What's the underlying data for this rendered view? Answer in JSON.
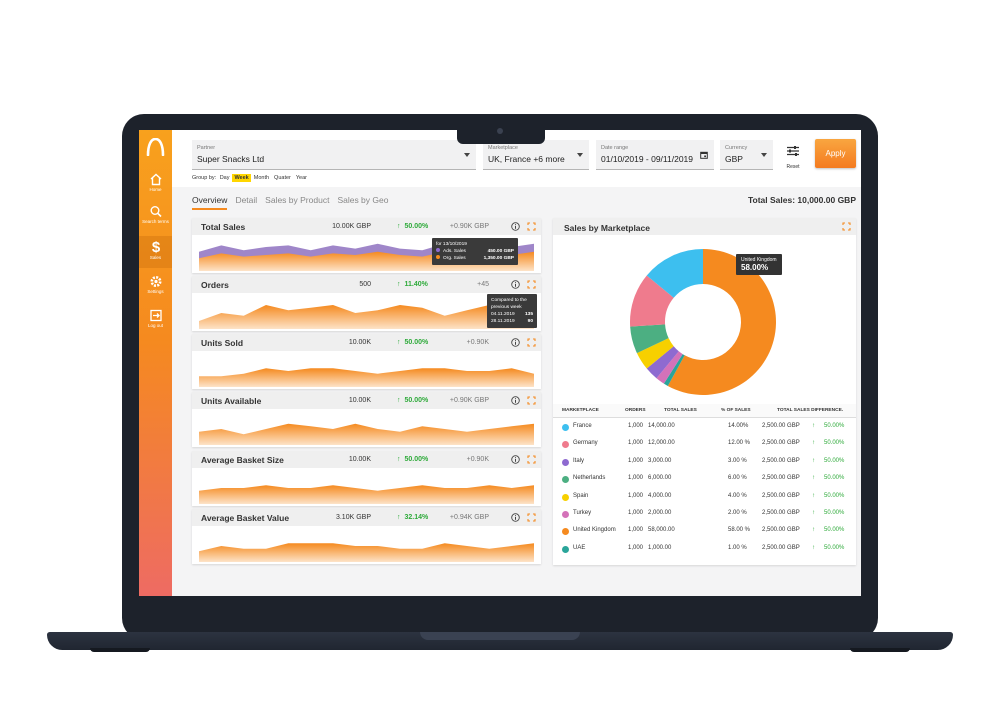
{
  "sidebar": {
    "items": [
      {
        "label": "Home",
        "icon": "home-icon"
      },
      {
        "label": "Search terms",
        "icon": "search-icon"
      },
      {
        "label": "Sales",
        "icon": "dollar-icon"
      },
      {
        "label": "Settings",
        "icon": "gear-icon"
      },
      {
        "label": "Log out",
        "icon": "logout-icon"
      }
    ]
  },
  "filters": {
    "partner": {
      "label": "Partner",
      "value": "Super Snacks Ltd"
    },
    "marketplace": {
      "label": "Marketplace",
      "value": "UK, France +6 more"
    },
    "date_range": {
      "label": "Date range",
      "value": "01/10/2019 - 09/11/2019"
    },
    "currency": {
      "label": "Currency",
      "value": "GBP"
    },
    "reset_label": "Reset",
    "apply_label": "Apply"
  },
  "group_by": {
    "label": "Group by:",
    "options": [
      "Day",
      "Week",
      "Month",
      "Quater",
      "Year"
    ],
    "selected": "Week"
  },
  "tabs": [
    "Overview",
    "Detail",
    "Sales by Product",
    "Sales by Geo"
  ],
  "total_sales": "Total Sales: 10,000.00 GBP",
  "metrics": [
    {
      "name": "Total Sales",
      "value": "10.00K GBP",
      "change": "50.00%",
      "diff": "+0.90K GBP"
    },
    {
      "name": "Orders",
      "value": "500",
      "change": "11.40%",
      "diff": "+45"
    },
    {
      "name": "Units Sold",
      "value": "10.00K",
      "change": "50.00%",
      "diff": "+0.90K"
    },
    {
      "name": "Units Available",
      "value": "10.00K",
      "change": "50.00%",
      "diff": "+0.90K GBP"
    },
    {
      "name": "Average Basket Size",
      "value": "10.00K",
      "change": "50.00%",
      "diff": "+0.90K"
    },
    {
      "name": "Average Basket Value",
      "value": "3.10K GBP",
      "change": "32.14%",
      "diff": "+0.94K GBP"
    }
  ],
  "tooltip_sales": {
    "title": "for 13/10/2019",
    "rows": [
      {
        "label": "Ads. Sales",
        "value": "450.00 GBP",
        "color": "#8e6ad0"
      },
      {
        "label": "Org. Sales",
        "value": "1,350.00 GBP",
        "color": "#f58a1f"
      }
    ]
  },
  "tooltip_orders": {
    "title_line1": "Compared to the",
    "title_line2": "previous week",
    "rows": [
      {
        "label": "04.11.2019",
        "value": "135"
      },
      {
        "label": "28.11.2019",
        "value": "90"
      }
    ]
  },
  "marketplace": {
    "title": "Sales by Marketplace",
    "tooltip": {
      "country": "United Kingdom",
      "value": "58.00%"
    },
    "headers": [
      "MARKETPLACE",
      "ORDERS",
      "TOTAL SALES",
      "% OF SALES",
      "TOTAL SALES DIFFERENCE."
    ],
    "rows": [
      {
        "country": "France",
        "orders": "1,000",
        "sales": "14,000.00",
        "pct": "14.00%",
        "diff": "2,500.00 GBP",
        "change": "50.00%",
        "color": "#3dbfef"
      },
      {
        "country": "Germany",
        "orders": "1,000",
        "sales": "12,000.00",
        "pct": "12.00 %",
        "diff": "2,500.00 GBP",
        "change": "50.00%",
        "color": "#ef7b8d"
      },
      {
        "country": "Italy",
        "orders": "1,000",
        "sales": "3,000.00",
        "pct": "3.00 %",
        "diff": "2,500.00 GBP",
        "change": "50.00%",
        "color": "#8e6ad0"
      },
      {
        "country": "Netherlands",
        "orders": "1,000",
        "sales": "6,000.00",
        "pct": "6.00 %",
        "diff": "2,500.00 GBP",
        "change": "50.00%",
        "color": "#4caf82"
      },
      {
        "country": "Spain",
        "orders": "1,000",
        "sales": "4,000.00",
        "pct": "4.00 %",
        "diff": "2,500.00 GBP",
        "change": "50.00%",
        "color": "#f7d000"
      },
      {
        "country": "Turkey",
        "orders": "1,000",
        "sales": "2,000.00",
        "pct": "2.00 %",
        "diff": "2,500.00 GBP",
        "change": "50.00%",
        "color": "#d472b9"
      },
      {
        "country": "United Kingdom",
        "orders": "1,000",
        "sales": "58,000.00",
        "pct": "58.00 %",
        "diff": "2,500.00 GBP",
        "change": "50.00%",
        "color": "#f58a1f"
      },
      {
        "country": "UAE",
        "orders": "1,000",
        "sales": "1,000.00",
        "pct": "1.00 %",
        "diff": "2,500.00 GBP",
        "change": "50.00%",
        "color": "#2aa59a"
      }
    ]
  },
  "chart_data": [
    {
      "type": "pie",
      "title": "Sales by Marketplace",
      "categories": [
        "France",
        "Germany",
        "Italy",
        "Netherlands",
        "Spain",
        "Turkey",
        "United Kingdom",
        "UAE"
      ],
      "values": [
        14,
        12,
        3,
        6,
        4,
        2,
        58,
        1
      ],
      "colors": [
        "#3dbfef",
        "#ef7b8d",
        "#8e6ad0",
        "#4caf82",
        "#f7d000",
        "#d472b9",
        "#f58a1f",
        "#2aa59a"
      ]
    },
    {
      "type": "area",
      "title": "Total Sales",
      "series": [
        {
          "name": "Org. Sales",
          "values": [
            8,
            11,
            9,
            10,
            11,
            9,
            11,
            10,
            12,
            10,
            9,
            12,
            11,
            9,
            10,
            12
          ]
        },
        {
          "name": "Ads. Sales",
          "values": [
            4,
            5,
            4,
            5,
            5,
            4,
            5,
            4,
            5,
            4,
            4,
            5,
            5,
            4,
            5,
            5
          ]
        }
      ]
    },
    {
      "type": "area",
      "title": "Orders",
      "values": [
        3,
        6,
        5,
        9,
        7,
        8,
        9,
        6,
        7,
        9,
        8,
        5,
        7,
        9,
        7,
        6
      ]
    },
    {
      "type": "area",
      "title": "Units Sold",
      "values": [
        4,
        4,
        5,
        7,
        6,
        7,
        7,
        6,
        5,
        6,
        7,
        7,
        6,
        6,
        7,
        5
      ]
    },
    {
      "type": "area",
      "title": "Units Available",
      "values": [
        5,
        6,
        4,
        6,
        8,
        7,
        6,
        8,
        6,
        5,
        7,
        6,
        5,
        6,
        7,
        8
      ]
    },
    {
      "type": "area",
      "title": "Average Basket Size",
      "values": [
        5,
        6,
        6,
        7,
        6,
        6,
        7,
        6,
        5,
        6,
        7,
        6,
        6,
        7,
        6,
        7
      ]
    },
    {
      "type": "area",
      "title": "Average Basket Value",
      "values": [
        4,
        6,
        5,
        5,
        7,
        7,
        7,
        6,
        6,
        5,
        5,
        7,
        6,
        5,
        6,
        7
      ]
    }
  ]
}
